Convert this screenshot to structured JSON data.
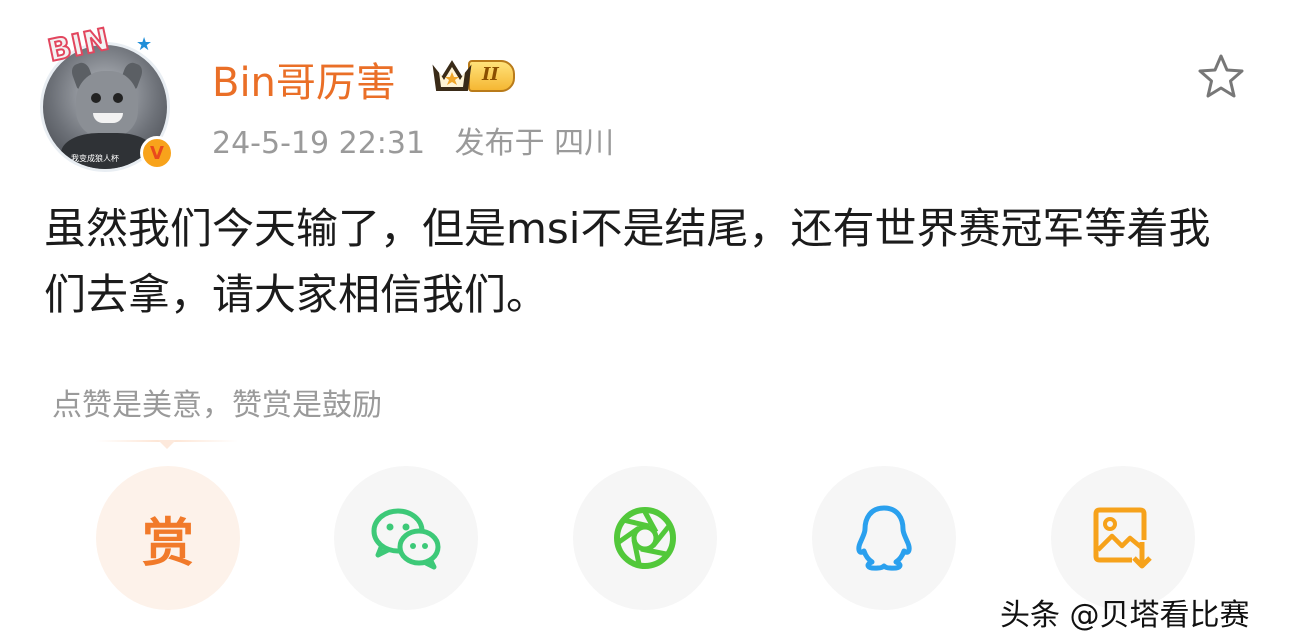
{
  "profile": {
    "avatar_caption": "我变成狼人杯",
    "avatar_badge": "BIN",
    "verified_mark": "V",
    "username": "Bin哥厉害",
    "vip_level": "II"
  },
  "post": {
    "timestamp": "24-5-19 22:31",
    "location": "发布于 四川",
    "text": "虽然我们今天输了，但是msi不是结尾，还有世界赛冠军等着我们去拿，请大家相信我们。"
  },
  "reward": {
    "tip": "点赞是美意，赞赏是鼓励",
    "button_label": "赏"
  },
  "share_targets": [
    {
      "name": "wechat",
      "icon": "wechat-icon",
      "color": "#3dc978"
    },
    {
      "name": "moments",
      "icon": "moments-icon",
      "color": "#52c83a"
    },
    {
      "name": "qq",
      "icon": "qq-icon",
      "color": "#2aa0ee"
    },
    {
      "name": "save-image",
      "icon": "save-image-icon",
      "color": "#f6a21b"
    }
  ],
  "watermark": "头条 @贝塔看比赛",
  "colors": {
    "username": "#ea6f27",
    "meta": "#9a9a9a",
    "reward": "#f17a2a"
  }
}
